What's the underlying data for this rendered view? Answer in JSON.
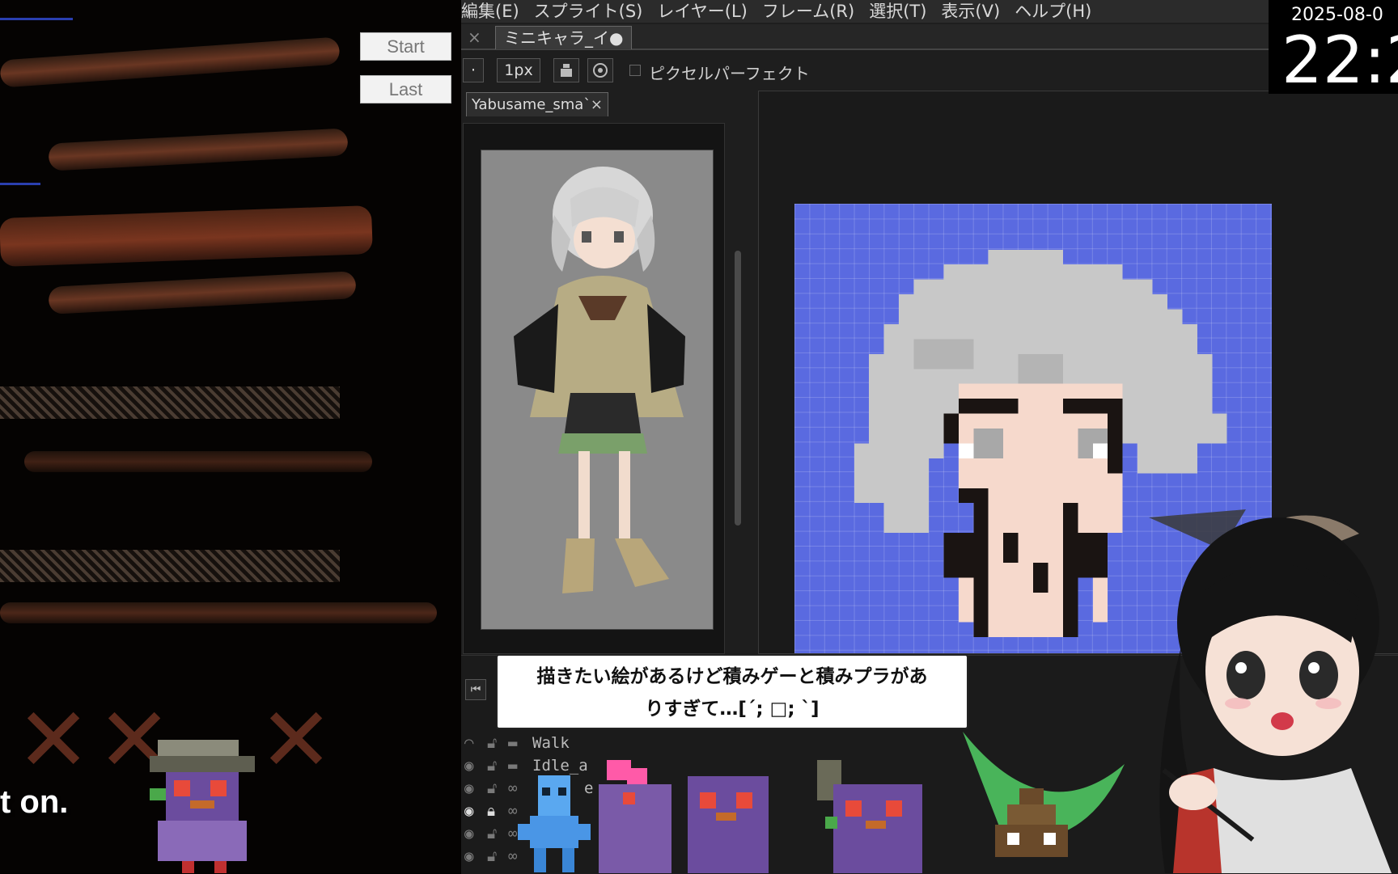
{
  "game": {
    "start_label": "Start",
    "last_label": "Last",
    "subtitle": "t on."
  },
  "menu": {
    "items": [
      "編集(E)",
      "スプライト(S)",
      "レイヤー(L)",
      "フレーム(R)",
      "選択(T)",
      "表示(V)",
      "ヘルプ(H)"
    ]
  },
  "tabs": {
    "close_glyph": "×",
    "active_tab": "ミニキャラ_イ●"
  },
  "toolbar": {
    "dot": "·",
    "brush_size": "1px",
    "pixel_perfect_label": "ピクセルパーフェクト"
  },
  "reference": {
    "tab_label": "Yabusame_sma`",
    "close_glyph": "×"
  },
  "layers": [
    {
      "name": "Walk",
      "kind": "folder"
    },
    {
      "name": "Idle_a",
      "kind": "folder"
    },
    {
      "name": "e",
      "kind": "layer"
    },
    {
      "name": "",
      "kind": "layer"
    },
    {
      "name": "",
      "kind": "layer"
    },
    {
      "name": "",
      "kind": "layer"
    }
  ],
  "timeline": {
    "first_frame_glyph": "⏮"
  },
  "bubble": {
    "line1": "描きたい絵があるけど積みゲーと積みプラがあ",
    "line2": "りすぎて…[´; □; `]"
  },
  "clock": {
    "date": "2025-08-0",
    "time": "22:2"
  },
  "colors": {
    "canvas_bg": "#5a6ae0",
    "hair": "#c8c8c8",
    "skin": "#f6d9cc",
    "outline": "#1a1412"
  }
}
